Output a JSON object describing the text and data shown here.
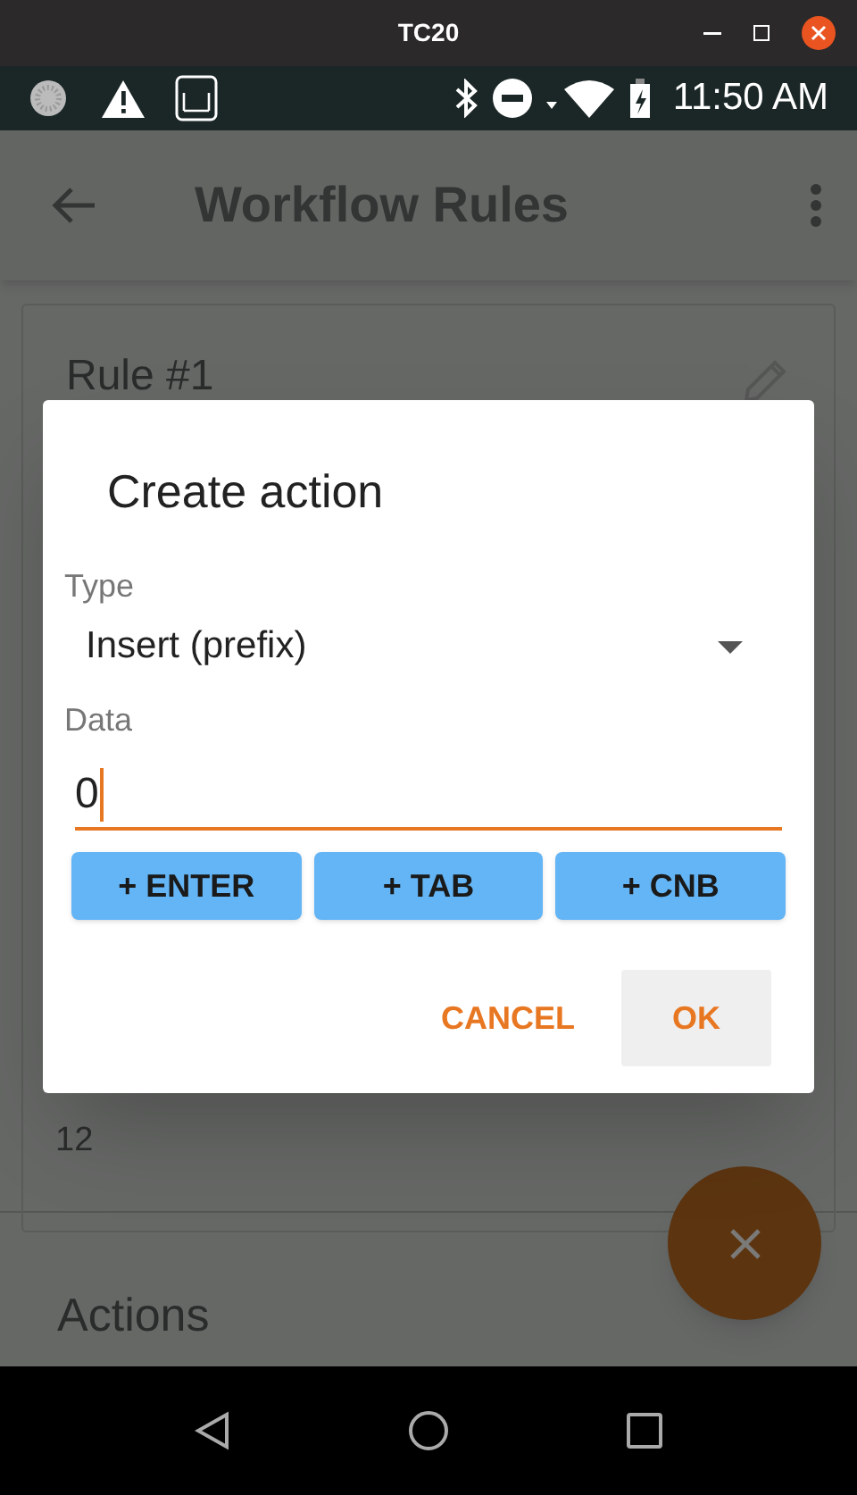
{
  "window": {
    "title": "TC20"
  },
  "status_bar": {
    "time": "11:50 AM"
  },
  "app_bar": {
    "title": "Workflow Rules"
  },
  "rule_card": {
    "title": "Rule #1",
    "value": "12"
  },
  "section": {
    "title": "Actions"
  },
  "dialog": {
    "title": "Create action",
    "type_field": {
      "label": "Type",
      "value": "Insert (prefix)"
    },
    "data_field": {
      "label": "Data",
      "value": "0",
      "focused": true
    },
    "insert_buttons": [
      "+ ENTER",
      "+ TAB",
      "+ CNB"
    ],
    "actions": [
      {
        "label": "CANCEL",
        "selected": false
      },
      {
        "label": "OK",
        "selected": true
      }
    ]
  }
}
